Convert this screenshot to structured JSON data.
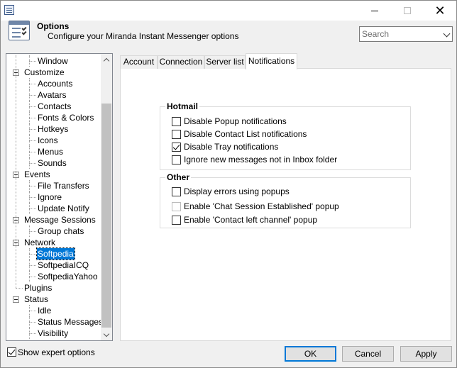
{
  "header": {
    "title": "Options",
    "subtitle": "Configure your Miranda Instant Messenger options"
  },
  "search": {
    "placeholder": "Search"
  },
  "tree": {
    "items": [
      {
        "label": "Window",
        "level": 1
      },
      {
        "label": "Customize",
        "level": 0,
        "expanded": true
      },
      {
        "label": "Accounts",
        "level": 1
      },
      {
        "label": "Avatars",
        "level": 1
      },
      {
        "label": "Contacts",
        "level": 1
      },
      {
        "label": "Fonts & Colors",
        "level": 1
      },
      {
        "label": "Hotkeys",
        "level": 1
      },
      {
        "label": "Icons",
        "level": 1
      },
      {
        "label": "Menus",
        "level": 1
      },
      {
        "label": "Sounds",
        "level": 1
      },
      {
        "label": "Events",
        "level": 0,
        "expanded": true
      },
      {
        "label": "File Transfers",
        "level": 1
      },
      {
        "label": "Ignore",
        "level": 1
      },
      {
        "label": "Update Notify",
        "level": 1
      },
      {
        "label": "Message Sessions",
        "level": 0,
        "expanded": true
      },
      {
        "label": "Group chats",
        "level": 1
      },
      {
        "label": "Network",
        "level": 0,
        "expanded": true
      },
      {
        "label": "Softpedia",
        "level": 1,
        "selected": true
      },
      {
        "label": "SoftpediaICQ",
        "level": 1
      },
      {
        "label": "SoftpediaYahoo",
        "level": 1
      },
      {
        "label": "Plugins",
        "level": 0
      },
      {
        "label": "Status",
        "level": 0,
        "expanded": true
      },
      {
        "label": "Idle",
        "level": 1
      },
      {
        "label": "Status Messages",
        "level": 1
      },
      {
        "label": "Visibility",
        "level": 1
      }
    ]
  },
  "tabs": [
    "Account",
    "Connection",
    "Server list",
    "Notifications"
  ],
  "active_tab": "Notifications",
  "groups": {
    "hotmail": {
      "title": "Hotmail",
      "options": [
        {
          "label": "Disable Popup notifications",
          "checked": false,
          "enabled": true
        },
        {
          "label": "Disable Contact List notifications",
          "checked": false,
          "enabled": true
        },
        {
          "label": "Disable Tray notifications",
          "checked": true,
          "enabled": true
        },
        {
          "label": "Ignore new messages not in Inbox folder",
          "checked": false,
          "enabled": true
        }
      ]
    },
    "other": {
      "title": "Other",
      "options": [
        {
          "label": "Display errors using popups",
          "checked": false,
          "enabled": true
        },
        {
          "label": "Enable 'Chat Session Established' popup",
          "checked": false,
          "enabled": false
        },
        {
          "label": "Enable 'Contact left channel' popup",
          "checked": false,
          "enabled": true
        }
      ]
    }
  },
  "footer": {
    "expert_label": "Show expert options",
    "expert_checked": true,
    "ok_label": "OK",
    "cancel_label": "Cancel",
    "apply_label": "Apply"
  },
  "colors": {
    "selection": "#0078d7",
    "default_button_border": "#0078d7"
  }
}
